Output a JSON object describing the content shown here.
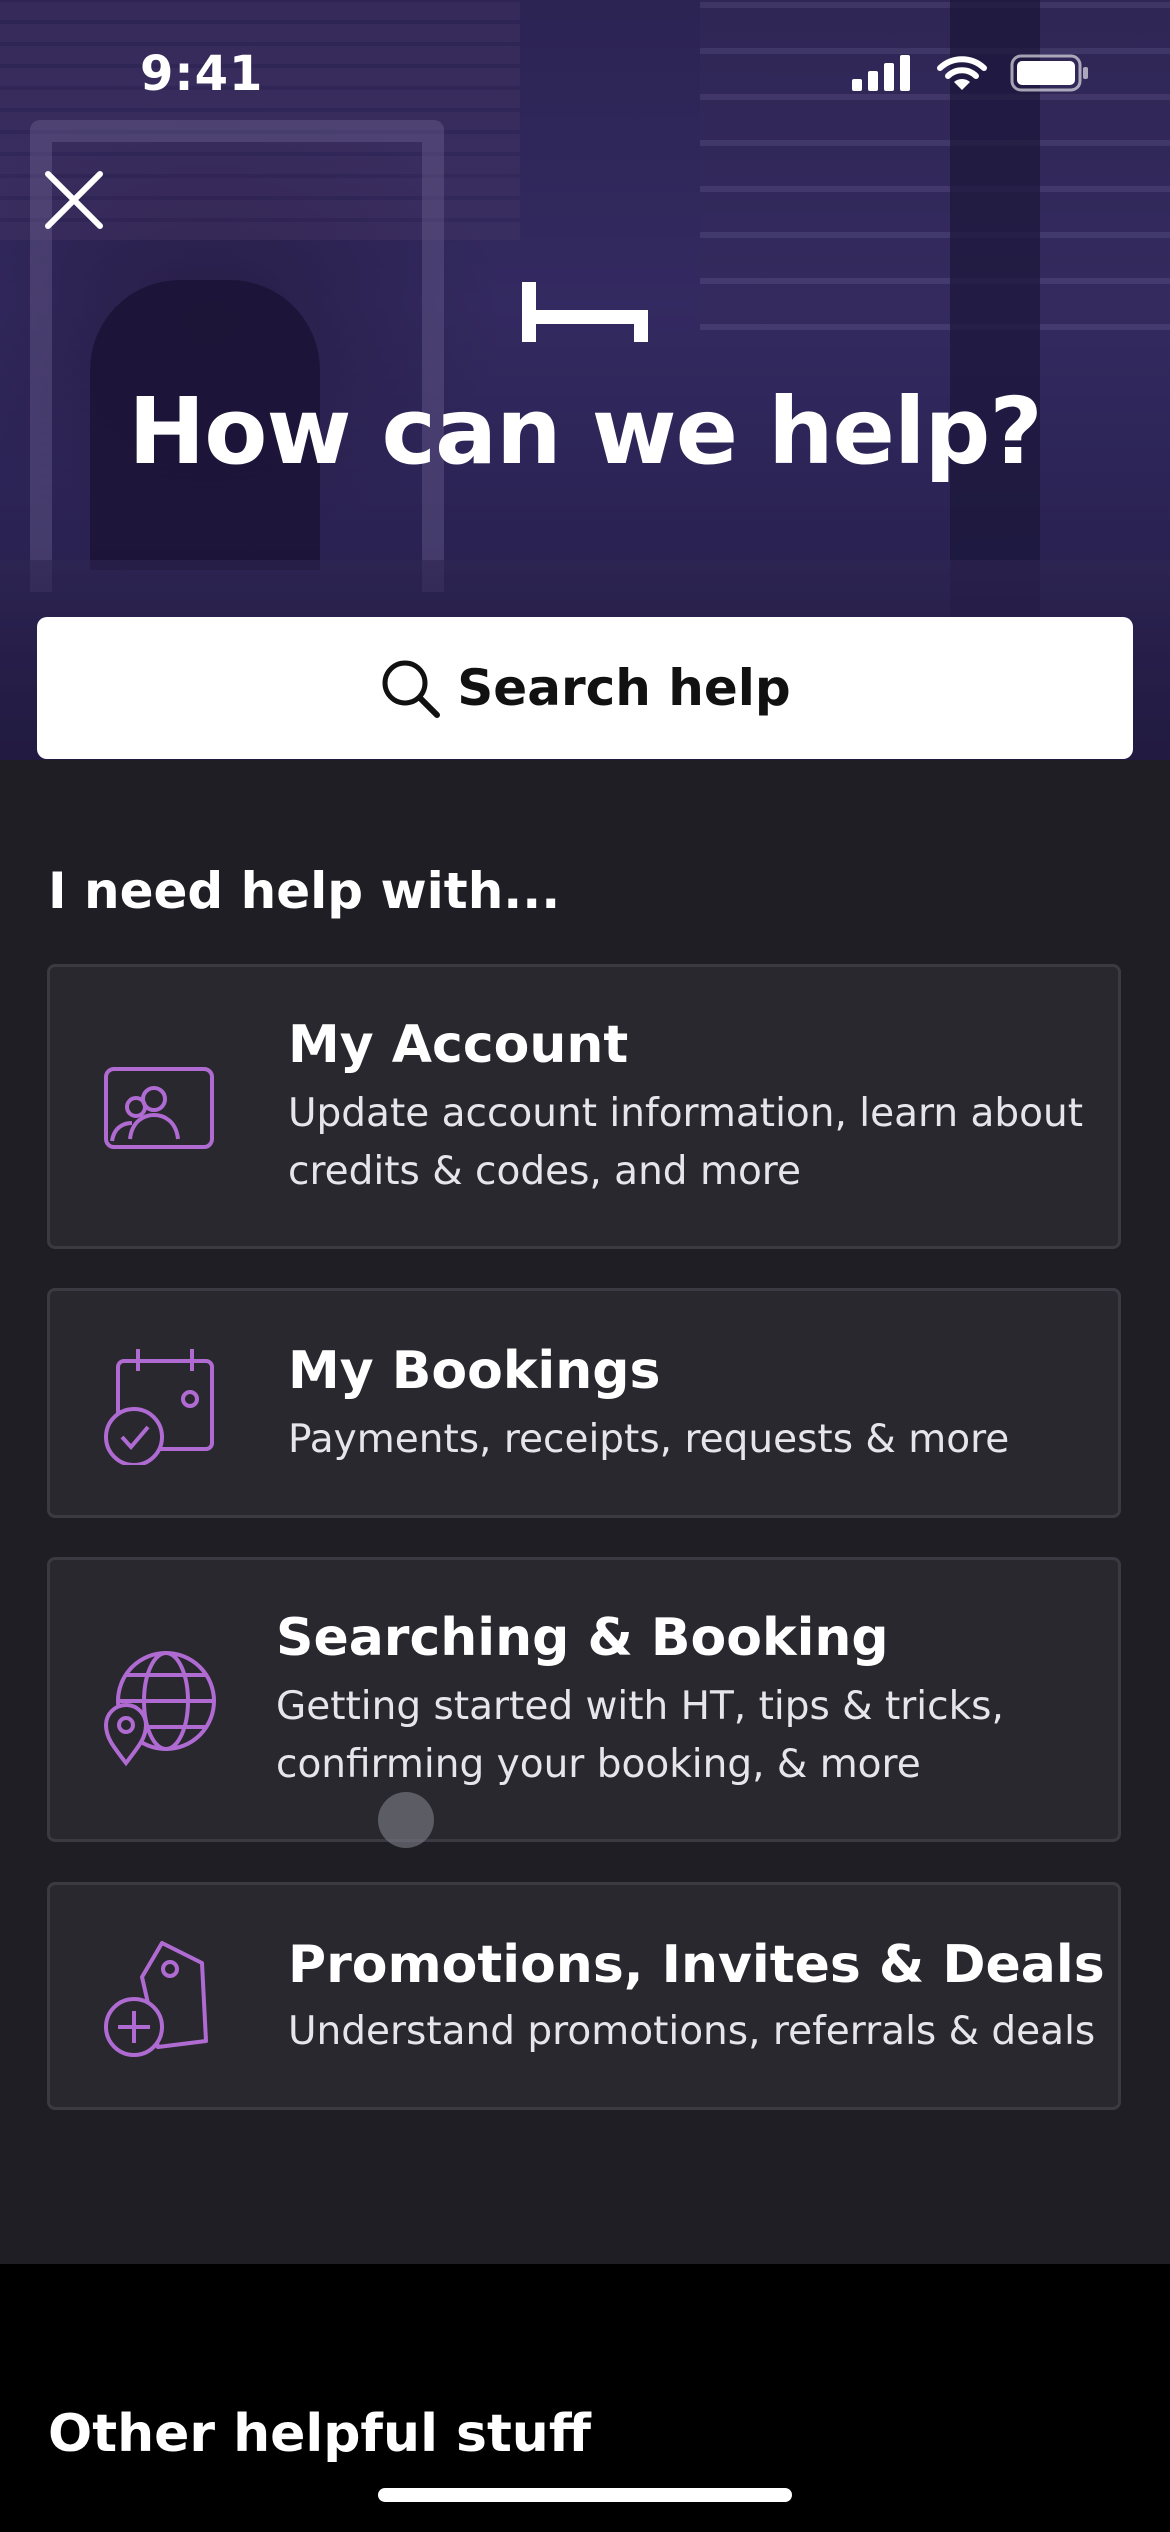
{
  "status_bar": {
    "time": "9:41"
  },
  "hero": {
    "headline": "How can we help?"
  },
  "search": {
    "label": "Search help"
  },
  "help_section": {
    "label": "I need help with...",
    "cards": [
      {
        "title": "My Account",
        "description": "Update account information, learn about credits & codes, and more",
        "icon": "account-screen-icon"
      },
      {
        "title": "My Bookings",
        "description": "Payments, receipts, requests & more",
        "icon": "calendar-check-icon"
      },
      {
        "title": "Searching & Booking",
        "description": "Getting started with HT, tips & tricks, confirming your booking, & more",
        "icon": "globe-pin-icon"
      },
      {
        "title": "Promotions, Invites & Deals",
        "description": "Understand promotions, referrals & deals",
        "icon": "tag-plus-icon"
      }
    ]
  },
  "footer": {
    "title": "Other helpful stuff"
  },
  "colors": {
    "accent_icon": "#b06bd3",
    "card_bg": "#29282f",
    "section_bg": "#1f1e24"
  }
}
